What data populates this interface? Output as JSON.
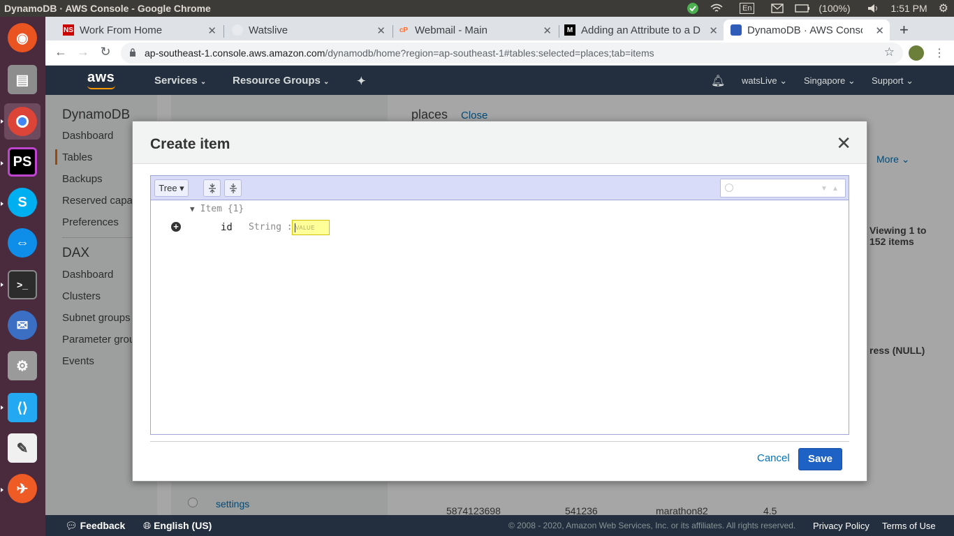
{
  "os": {
    "window_title": "DynamoDB · AWS Console - Google Chrome",
    "lang": "En",
    "battery": "(100%)",
    "clock": "1:51 PM"
  },
  "browser": {
    "tabs": [
      {
        "title": "Work From Home",
        "favicon": "NS"
      },
      {
        "title": "Watslive",
        "favicon": ""
      },
      {
        "title": "Webmail - Main",
        "favicon": "cP"
      },
      {
        "title": "Adding an Attribute to a D",
        "favicon": "M"
      },
      {
        "title": "DynamoDB · AWS Console",
        "favicon": "db"
      }
    ],
    "url_host": "ap-southeast-1.console.aws.amazon.com",
    "url_path": "/dynamodb/home?region=ap-southeast-1#tables:selected=places;tab=items"
  },
  "aws": {
    "logo": "aws",
    "services": "Services",
    "resource_groups": "Resource Groups",
    "user": "watsLive",
    "region": "Singapore",
    "support": "Support"
  },
  "sidebar": {
    "section1": "DynamoDB",
    "items1": [
      "Dashboard",
      "Tables",
      "Backups",
      "Reserved capacity",
      "Preferences"
    ],
    "section2": "DAX",
    "items2": [
      "Dashboard",
      "Clusters",
      "Subnet groups",
      "Parameter groups",
      "Events"
    ]
  },
  "table_panel": {
    "title": "places",
    "close": "Close",
    "more": "More",
    "viewing": "Viewing 1 to 152 items",
    "col_null": "ress (NULL)",
    "row": [
      "5874123698",
      "541236",
      "marathon82",
      "4.5"
    ],
    "left_item": "settings"
  },
  "modal": {
    "title": "Create item",
    "mode": "Tree ▾",
    "root_label": "Item {1}",
    "field_name": "id",
    "field_type": "String :",
    "value_placeholder": "VALUE",
    "cancel": "Cancel",
    "save": "Save"
  },
  "footer": {
    "feedback": "Feedback",
    "language": "English (US)",
    "copyright": "© 2008 - 2020, Amazon Web Services, Inc. or its affiliates. All rights reserved.",
    "privacy": "Privacy Policy",
    "terms": "Terms of Use"
  }
}
